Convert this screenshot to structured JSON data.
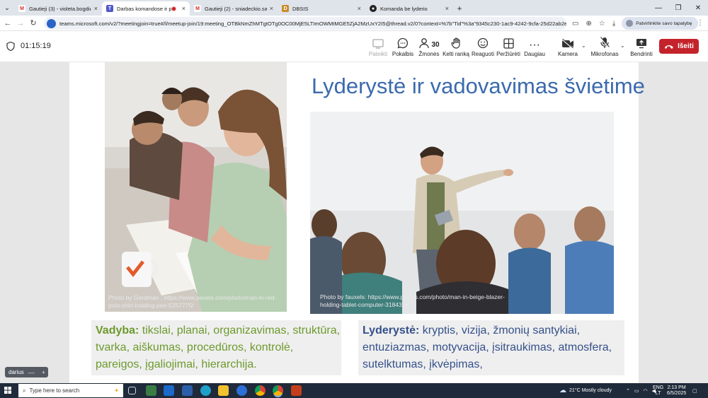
{
  "browser": {
    "tabs": [
      {
        "title": "Gautieji (3) - violeta.bogdiun@...",
        "favicon": "gmail-icon",
        "active": false
      },
      {
        "title": "Darbas komandose ir pasid...",
        "favicon": "teams-icon",
        "active": true
      },
      {
        "title": "Gautieji (2) - sniadeckio.salcinin...",
        "favicon": "gmail-icon",
        "active": false
      },
      {
        "title": "DBSIS",
        "favicon": "dbsis-icon",
        "active": false
      },
      {
        "title": "Komanda be lyderio",
        "favicon": "github-icon",
        "active": false
      }
    ],
    "url": "teams.microsoft.com/v2/?meetingjoin=true#/l/meetup-join/19:meeting_OTBkNmZhMTgtOTg0OC00MjE5LTImOWMtMGE5ZjA2MzUxY2I5@thread.v2/0?context=%7b\"Tid\"%3a\"9345c230-1ac9-4242-9cfa-25d22ab2ed71\"%2...",
    "profile_label": "Patvirtinkite savo tapatybę"
  },
  "meeting": {
    "timer": "01:15:19",
    "people_count": "30",
    "toolbar": {
      "present": "Pateikti",
      "chat": "Pokalbis",
      "people": "Žmonės",
      "raise_hand": "Kelti ranką",
      "react": "Reaguoti",
      "view": "Peržiūrėti",
      "more": "Daugiau",
      "camera": "Kamera",
      "mic": "Mikrofonas",
      "share": "Bendrinti",
      "leave": "Išeiti"
    },
    "participant_name": "darius"
  },
  "slide": {
    "title": "Lyderystė ir vadovavimas švietime",
    "photo1_credit": "Photo by Gerdman : https://www.pexels.com/photo/man-in-red-polo-shirt-holding-pen-5257775/",
    "photo2_credit": "Photo by fauxels: https://www.pexels.com/photo/man-in-beige-blazer-holding-tablet-computer-3184328/",
    "left_box": {
      "term": "Vadyba:",
      "text": " tikslai, planai, organizavimas, struktūra, tvarka, aiškumas, procedūros, kontrolė, pareigos, įgaliojimai, hierarchija."
    },
    "right_box": {
      "term": "Lyderystė:",
      "text": " kryptis, vizija, žmonių santykiai, entuziazmas, motyvacija, įsitraukimas, atmosfera, sutelktumas, įkvėpimas,"
    }
  },
  "taskbar": {
    "search_placeholder": "Type here to search",
    "weather": "21°C  Mostly cloudy",
    "lang_line1": "ENG",
    "lang_line2": "LT",
    "time": "2:13 PM",
    "date": "6/5/2025"
  },
  "colors": {
    "teams_accent": "#c4232b",
    "slide_title": "#3b6aae",
    "vadyba_green": "#6d9a2d",
    "lyderyste_blue": "#34508a"
  }
}
